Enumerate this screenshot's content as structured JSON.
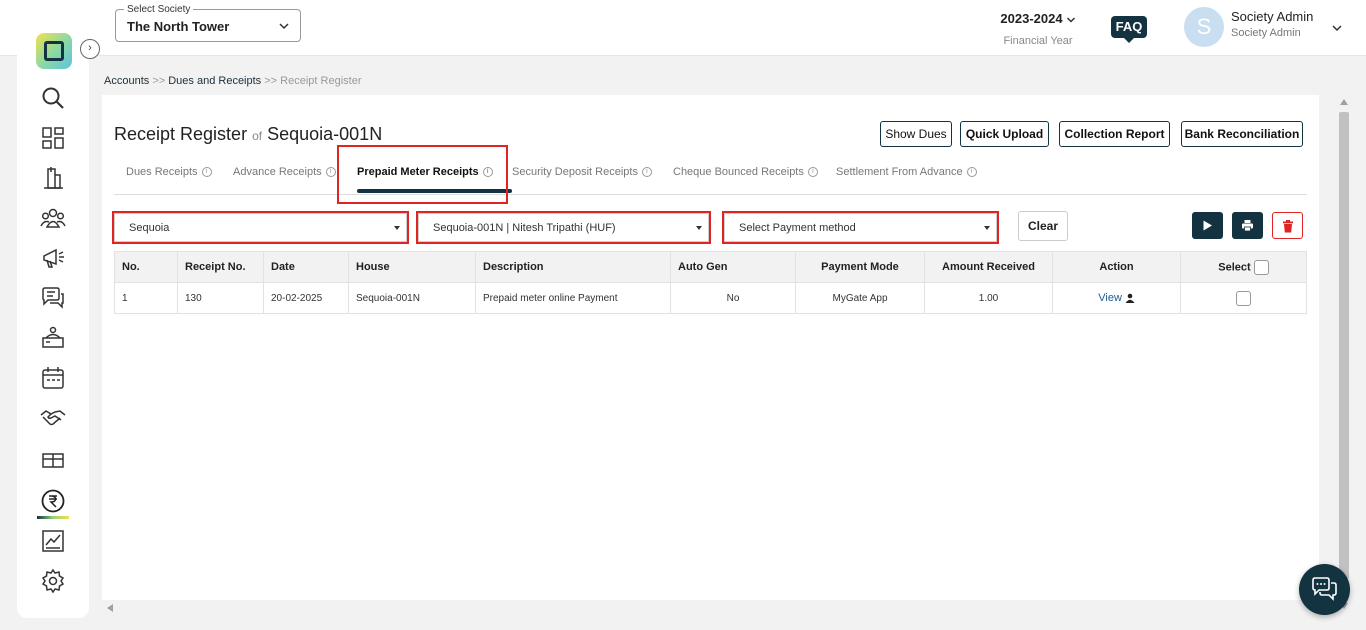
{
  "header": {
    "society_select_label": "Select Society",
    "society_select_value": "The North Tower",
    "financial_year": "2023-2024",
    "financial_year_label": "Financial Year",
    "faq_label": "FAQ",
    "avatar_initial": "S",
    "user_name": "Society Admin",
    "user_role": "Society Admin"
  },
  "sidebar": {
    "toggle_glyph": "›",
    "items": [
      "search",
      "dashboard",
      "building",
      "members",
      "announcements",
      "chat",
      "services",
      "calendar",
      "handshake",
      "parcel",
      "accounts",
      "reports",
      "settings"
    ],
    "active": "accounts"
  },
  "breadcrumb": {
    "items": [
      "Accounts",
      "Dues and Receipts",
      "Receipt Register"
    ],
    "separator": ">>"
  },
  "page": {
    "title": "Receipt Register",
    "title_of": "of",
    "title_unit": "Sequoia-001N"
  },
  "actions": {
    "show_dues": "Show Dues",
    "quick_upload": "Quick Upload",
    "collection_report": "Collection Report",
    "bank_reconciliation": "Bank Reconciliation"
  },
  "tabs": [
    {
      "label": "Dues Receipts",
      "active": false
    },
    {
      "label": "Advance Receipts",
      "active": false
    },
    {
      "label": "Prepaid Meter Receipts",
      "active": true
    },
    {
      "label": "Security Deposit Receipts",
      "active": false
    },
    {
      "label": "Cheque Bounced Receipts",
      "active": false
    },
    {
      "label": "Settlement From Advance",
      "active": false
    }
  ],
  "filters": {
    "building": "Sequoia",
    "unit": "Sequoia-001N | Nitesh Tripathi (HUF)",
    "payment_method": "Select Payment method",
    "clear_label": "Clear"
  },
  "table": {
    "columns": [
      "No.",
      "Receipt No.",
      "Date",
      "House",
      "Description",
      "Auto Gen",
      "Payment Mode",
      "Amount Received",
      "Action",
      "Select"
    ],
    "rows": [
      {
        "no": "1",
        "receipt_no": "130",
        "date": "20-02-2025",
        "house": "Sequoia-001N",
        "description": "Prepaid meter online Payment",
        "auto_gen": "No",
        "payment_mode": "MyGate App",
        "amount_received": "1.00",
        "action": "View"
      }
    ]
  },
  "colors": {
    "brand_dark": "#12333f",
    "highlight_red": "#e02424",
    "link_blue": "#1a5b95"
  }
}
